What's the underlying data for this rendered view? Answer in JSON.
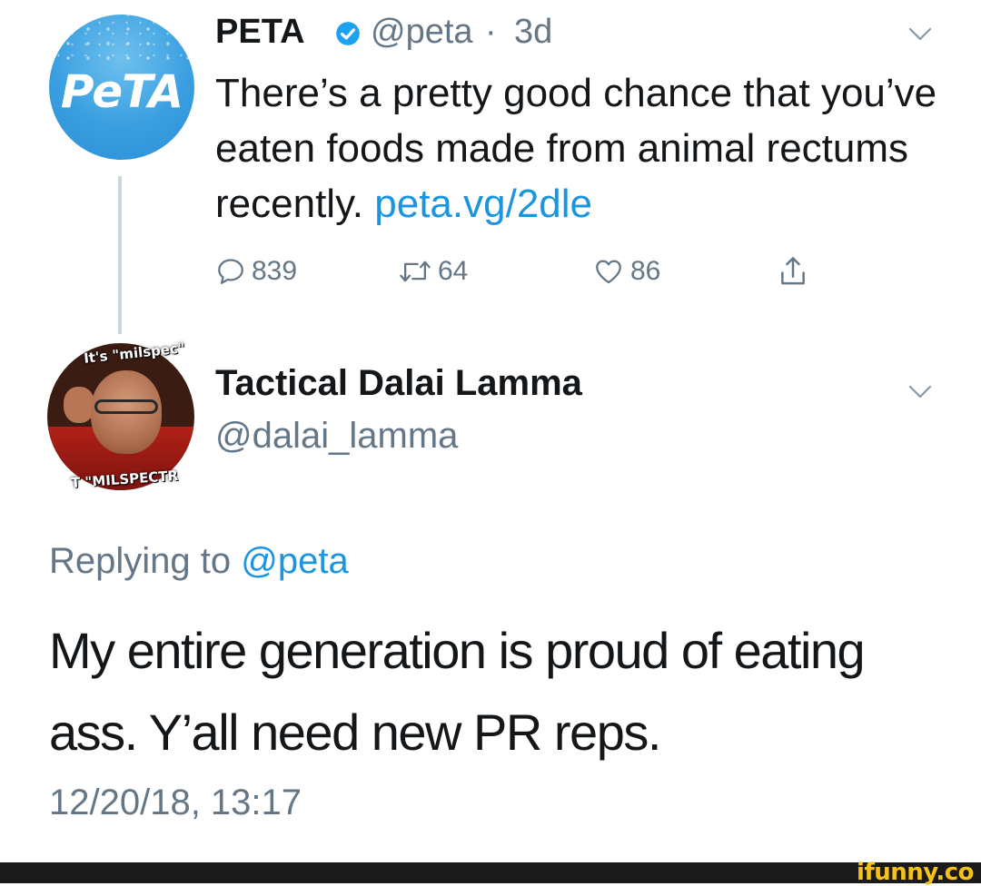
{
  "colors": {
    "text": "#14171a",
    "muted": "#657786",
    "link": "#1b95e0",
    "verified": "#1da1f2",
    "thread_line": "#ccd6dd",
    "watermark": "#f4c21a"
  },
  "parent_tweet": {
    "avatar_label": "PeTA",
    "name": "PETA",
    "handle": "@peta",
    "separator": "·",
    "time": "3d",
    "text": "There’s a pretty good chance that you’ve eaten foods made from animal rectums recently.",
    "link": "peta.vg/2dle",
    "actions": {
      "replies": "839",
      "retweets": "64",
      "likes": "86"
    },
    "icons": [
      "verified-badge-icon",
      "chevron-down-icon",
      "reply-icon",
      "retweet-icon",
      "heart-icon",
      "share-icon"
    ]
  },
  "reply_tweet": {
    "avatar_caption_top": "It's \"milspec\"",
    "avatar_caption_bottom": "T \"MILSPECTR",
    "name": "Tactical Dalai Lamma",
    "handle": "@dalai_lamma",
    "replying_prefix": "Replying to",
    "replying_mention": "@peta",
    "text": "My entire generation is proud of eating ass. Y’all need new PR reps.",
    "timestamp": "12/20/18, 13:17"
  },
  "watermark": "ifunny.co"
}
